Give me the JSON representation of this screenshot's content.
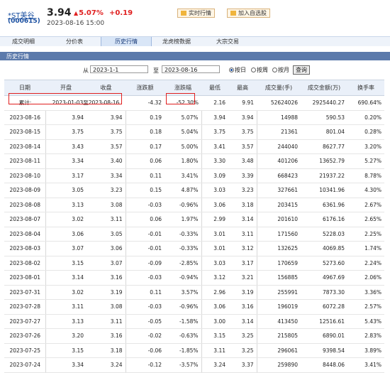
{
  "header": {
    "stock_name": "*ST美谷",
    "stock_code": "(000615)",
    "price": "3.94",
    "change_pct": "5.07%",
    "change": "+0.19",
    "datetime": "2023-08-16 15:00",
    "realtime_button": "实时行情",
    "watchlist_button": "加入自选股",
    "up_color": "#e02020"
  },
  "tabs": [
    "成交明细",
    "分价表",
    "历史行情",
    "龙虎榜数据",
    "大宗交易"
  ],
  "active_tab": "历史行情",
  "section_title": "历史行情",
  "query": {
    "from_label": "从",
    "from_value": "2023-1-1",
    "to_label": "至",
    "to_value": "2023-08-16",
    "options": [
      "按日",
      "按周",
      "按月"
    ],
    "selected": "按日",
    "submit": "查询"
  },
  "table": {
    "headers": [
      "日期",
      "开盘",
      "收盘",
      "涨跌额",
      "涨跌幅",
      "最低",
      "最高",
      "成交量(手)",
      "成交金额(万)",
      "换手率"
    ],
    "summary": [
      "累计:",
      "2023-01-03至2023-08-16",
      "-4.32",
      "-52.30%",
      "2.16",
      "9.91",
      "52624026",
      "2925440.27",
      "690.64%"
    ],
    "rows": [
      [
        "2023-08-16",
        "3.94",
        "3.94",
        "0.19",
        "5.07%",
        "3.94",
        "3.94",
        "14988",
        "590.53",
        "0.20%"
      ],
      [
        "2023-08-15",
        "3.75",
        "3.75",
        "0.18",
        "5.04%",
        "3.75",
        "3.75",
        "21361",
        "801.04",
        "0.28%"
      ],
      [
        "2023-08-14",
        "3.43",
        "3.57",
        "0.17",
        "5.00%",
        "3.41",
        "3.57",
        "244040",
        "8627.77",
        "3.20%"
      ],
      [
        "2023-08-11",
        "3.34",
        "3.40",
        "0.06",
        "1.80%",
        "3.30",
        "3.48",
        "401206",
        "13652.79",
        "5.27%"
      ],
      [
        "2023-08-10",
        "3.17",
        "3.34",
        "0.11",
        "3.41%",
        "3.09",
        "3.39",
        "668423",
        "21937.22",
        "8.78%"
      ],
      [
        "2023-08-09",
        "3.05",
        "3.23",
        "0.15",
        "4.87%",
        "3.03",
        "3.23",
        "327661",
        "10341.96",
        "4.30%"
      ],
      [
        "2023-08-08",
        "3.13",
        "3.08",
        "-0.03",
        "-0.96%",
        "3.06",
        "3.18",
        "203415",
        "6361.96",
        "2.67%"
      ],
      [
        "2023-08-07",
        "3.02",
        "3.11",
        "0.06",
        "1.97%",
        "2.99",
        "3.14",
        "201610",
        "6176.16",
        "2.65%"
      ],
      [
        "2023-08-04",
        "3.06",
        "3.05",
        "-0.01",
        "-0.33%",
        "3.01",
        "3.11",
        "171560",
        "5228.03",
        "2.25%"
      ],
      [
        "2023-08-03",
        "3.07",
        "3.06",
        "-0.01",
        "-0.33%",
        "3.01",
        "3.12",
        "132625",
        "4069.85",
        "1.74%"
      ],
      [
        "2023-08-02",
        "3.15",
        "3.07",
        "-0.09",
        "-2.85%",
        "3.03",
        "3.17",
        "170659",
        "5273.60",
        "2.24%"
      ],
      [
        "2023-08-01",
        "3.14",
        "3.16",
        "-0.03",
        "-0.94%",
        "3.12",
        "3.21",
        "156885",
        "4967.69",
        "2.06%"
      ],
      [
        "2023-07-31",
        "3.02",
        "3.19",
        "0.11",
        "3.57%",
        "2.96",
        "3.19",
        "255991",
        "7873.30",
        "3.36%"
      ],
      [
        "2023-07-28",
        "3.11",
        "3.08",
        "-0.03",
        "-0.96%",
        "3.06",
        "3.16",
        "196019",
        "6072.28",
        "2.57%"
      ],
      [
        "2023-07-27",
        "3.13",
        "3.11",
        "-0.05",
        "-1.58%",
        "3.00",
        "3.14",
        "413450",
        "12516.61",
        "5.43%"
      ],
      [
        "2023-07-26",
        "3.20",
        "3.16",
        "-0.02",
        "-0.63%",
        "3.15",
        "3.25",
        "215805",
        "6890.01",
        "2.83%"
      ],
      [
        "2023-07-25",
        "3.15",
        "3.18",
        "-0.06",
        "-1.85%",
        "3.11",
        "3.25",
        "296061",
        "9398.54",
        "3.89%"
      ],
      [
        "2023-07-24",
        "3.34",
        "3.24",
        "-0.12",
        "-3.57%",
        "3.24",
        "3.37",
        "259890",
        "8448.06",
        "3.41%"
      ]
    ]
  }
}
